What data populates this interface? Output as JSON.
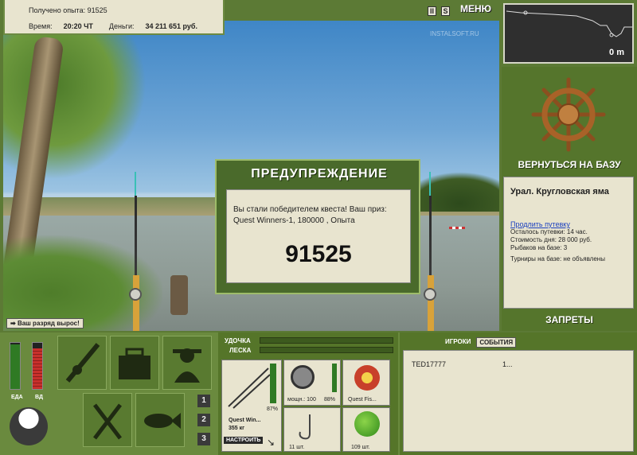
{
  "info": {
    "xp_label": "Получено опыта: 91525",
    "time_label": "Время:",
    "time_value": "20:20 ЧТ",
    "money_label": "Деньги:",
    "money_value": "34 211 651 руб."
  },
  "top": {
    "pause": "II",
    "speed": "S",
    "menu": "МЕНЮ",
    "logo": "INSTALSOFT.RU"
  },
  "depth": {
    "value": "0 m"
  },
  "right": {
    "return_label": "ВЕРНУТЬСЯ НА БАЗУ",
    "location": "Урал. Кругловская яма",
    "extend_link": "Продлить путевку",
    "remain": "Осталось путевки: 14 час.",
    "cost": "Стоимость дня: 28 000 руб.",
    "fishers": "Рыбаков на базе: 3",
    "tournaments": "Турниры на базе: не объявлены",
    "bans_label": "ЗАПРЕТЫ"
  },
  "dialog": {
    "title": "ПРЕДУПРЕЖДЕНИЕ",
    "message": "Вы стали победителем квеста! Ваш приз: Quest Winners-1, 180000 , Опыта",
    "value": "91525"
  },
  "rank": {
    "label": "Ваш разряд вырос!"
  },
  "needs": {
    "food_label": "ЕДА",
    "drink_label": "ВД",
    "food_level": 0.97,
    "drink_level": 0.88
  },
  "rod_panel": {
    "rod_label": "УДОЧКА",
    "line_label": "ЛЕСКА",
    "rod_name": "Quest Win...",
    "rod_weight": "355 кг",
    "rod_percent": "87%",
    "setup_label": "НАСТРОИТЬ",
    "reel_caption": "мощн.: 100",
    "reel_percent": "88%",
    "line_caption": "Quest Fis...",
    "hook_caption": "11 шт.",
    "bait_caption": "109 шт."
  },
  "slots": [
    "1",
    "2",
    "3"
  ],
  "players": {
    "tab_players": "ИГРОКИ",
    "tab_events": "СОБЫТИЯ",
    "rows": [
      {
        "name": "TED17777",
        "value": "1..."
      }
    ]
  },
  "colors": {
    "panel": "#5c7a35",
    "paper": "#e8e4cf",
    "food": "#2f7a24",
    "drink": "#c9302c"
  }
}
